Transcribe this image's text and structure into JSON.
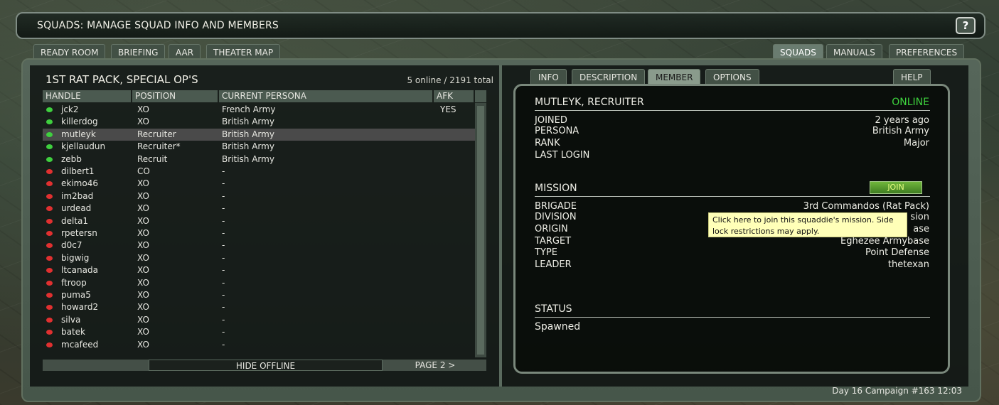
{
  "window": {
    "title": "SQUADS: MANAGE SQUAD INFO AND MEMBERS",
    "help_label": "?"
  },
  "top_tabs_left": [
    "READY ROOM",
    "BRIEFING",
    "AAR",
    "THEATER MAP"
  ],
  "top_tabs_right": [
    {
      "label": "SQUADS",
      "active": true
    },
    {
      "label": "MANUALS",
      "active": false
    },
    {
      "label": "PREFERENCES",
      "active": false
    }
  ],
  "squad": {
    "name": "1ST RAT PACK, SPECIAL OP'S",
    "online_count": "5 online / 2191 total",
    "columns": [
      "HANDLE",
      "POSITION",
      "CURRENT PERSONA",
      "AFK"
    ],
    "members": [
      {
        "handle": "jck2",
        "position": "XO",
        "persona": "French Army",
        "afk": "YES",
        "online": true
      },
      {
        "handle": "killerdog",
        "position": "XO",
        "persona": "British Army",
        "afk": "",
        "online": true
      },
      {
        "handle": "mutleyk",
        "position": "Recruiter",
        "persona": "British Army",
        "afk": "",
        "online": true,
        "selected": true
      },
      {
        "handle": "kjellaudun",
        "position": "Recruiter*",
        "persona": "British Army",
        "afk": "",
        "online": true
      },
      {
        "handle": "zebb",
        "position": "Recruit",
        "persona": "British Army",
        "afk": "",
        "online": true
      },
      {
        "handle": "dilbert1",
        "position": "CO",
        "persona": "-",
        "afk": "",
        "online": false
      },
      {
        "handle": "ekimo46",
        "position": "XO",
        "persona": "-",
        "afk": "",
        "online": false
      },
      {
        "handle": "im2bad",
        "position": "XO",
        "persona": "-",
        "afk": "",
        "online": false
      },
      {
        "handle": "urdead",
        "position": "XO",
        "persona": "-",
        "afk": "",
        "online": false
      },
      {
        "handle": "delta1",
        "position": "XO",
        "persona": "-",
        "afk": "",
        "online": false
      },
      {
        "handle": "rpetersn",
        "position": "XO",
        "persona": "-",
        "afk": "",
        "online": false
      },
      {
        "handle": "d0c7",
        "position": "XO",
        "persona": "-",
        "afk": "",
        "online": false
      },
      {
        "handle": "bigwig",
        "position": "XO",
        "persona": "-",
        "afk": "",
        "online": false
      },
      {
        "handle": "ltcanada",
        "position": "XO",
        "persona": "-",
        "afk": "",
        "online": false
      },
      {
        "handle": "ftroop",
        "position": "XO",
        "persona": "-",
        "afk": "",
        "online": false
      },
      {
        "handle": "puma5",
        "position": "XO",
        "persona": "-",
        "afk": "",
        "online": false
      },
      {
        "handle": "howard2",
        "position": "XO",
        "persona": "-",
        "afk": "",
        "online": false
      },
      {
        "handle": "silva",
        "position": "XO",
        "persona": "-",
        "afk": "",
        "online": false
      },
      {
        "handle": "batek",
        "position": "XO",
        "persona": "-",
        "afk": "",
        "online": false
      },
      {
        "handle": "mcafeed",
        "position": "XO",
        "persona": "-",
        "afk": "",
        "online": false
      }
    ],
    "hide_offline_label": "HIDE OFFLINE",
    "page_label": "PAGE 2 >"
  },
  "detail_tabs": [
    {
      "label": "INFO",
      "active": false
    },
    {
      "label": "DESCRIPTION",
      "active": false
    },
    {
      "label": "MEMBER",
      "active": true
    },
    {
      "label": "OPTIONS",
      "active": false
    }
  ],
  "detail_help_label": "HELP",
  "member": {
    "header": "MUTLEYK, RECRUITER",
    "status": "ONLINE",
    "fields": [
      {
        "key": "JOINED",
        "value": "2 years ago"
      },
      {
        "key": "PERSONA",
        "value": "British Army"
      },
      {
        "key": "RANK",
        "value": "Major"
      },
      {
        "key": "LAST LOGIN",
        "value": ""
      }
    ]
  },
  "mission": {
    "header": "MISSION",
    "join_label": "JOIN",
    "fields": [
      {
        "key": "BRIGADE",
        "value": "3rd Commandos (Rat Pack)"
      },
      {
        "key": "DIVISION",
        "value": "sion"
      },
      {
        "key": "ORIGIN",
        "value": "ase"
      },
      {
        "key": "TARGET",
        "value": "Eghezee Armybase"
      },
      {
        "key": "TYPE",
        "value": "Point Defense"
      },
      {
        "key": "LEADER",
        "value": "thetexan"
      }
    ],
    "tooltip": "Click here to join this squaddie's mission. Side lock restrictions may apply."
  },
  "status_section": {
    "header": "STATUS",
    "value": "Spawned"
  },
  "footer": {
    "campaign": "Day 16 Campaign #163",
    "time": "12:03"
  },
  "colors": {
    "online_dot": "#3fcf3f",
    "offline_dot": "#e03030",
    "online_text": "#3ed43e",
    "tooltip_bg": "#ffffb8"
  }
}
